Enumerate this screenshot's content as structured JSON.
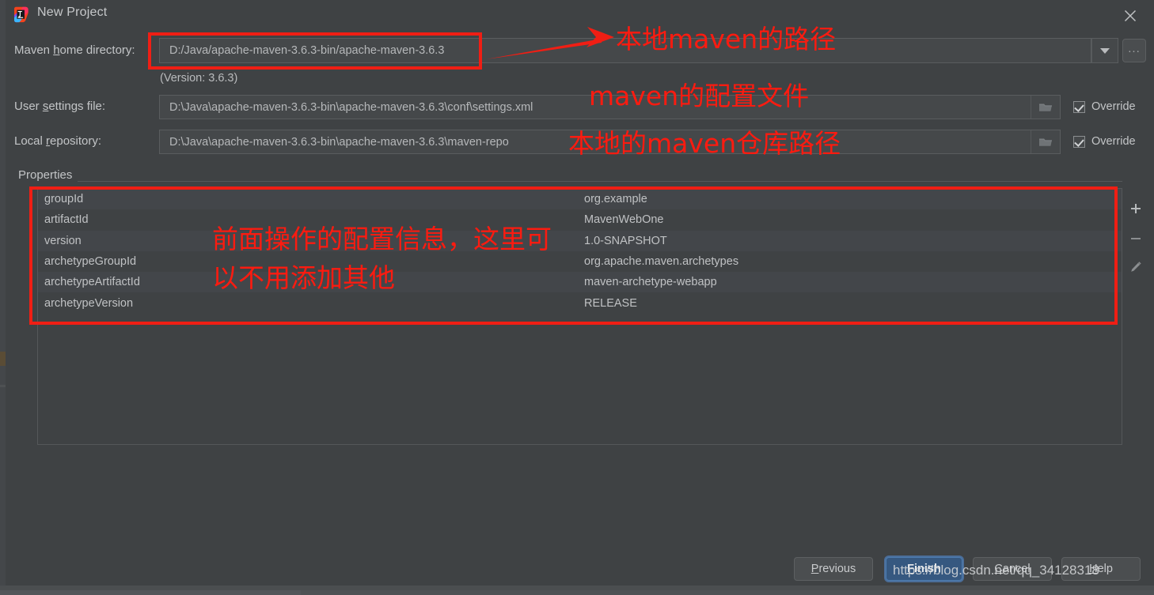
{
  "window": {
    "title": "New Project",
    "app_icon": "intellij-idea-icon",
    "close_icon": "close-icon"
  },
  "form": {
    "maven_home": {
      "label_pre": "Maven ",
      "label_mnemonic": "h",
      "label_post": "ome directory:",
      "value": "D:/Java/apache-maven-3.6.3-bin/apache-maven-3.6.3",
      "dropdown_icon": "chevron-down-icon",
      "browse_label": "...",
      "version_note": "(Version: 3.6.3)"
    },
    "user_settings": {
      "label_pre": "User ",
      "label_mnemonic": "s",
      "label_post": "ettings file:",
      "value": "D:\\Java\\apache-maven-3.6.3-bin\\apache-maven-3.6.3\\conf\\settings.xml",
      "folder_icon": "folder-icon",
      "override_label": "Override",
      "override_checked": true
    },
    "local_repository": {
      "label_pre": "Local ",
      "label_mnemonic": "r",
      "label_post": "epository:",
      "value": "D:\\Java\\apache-maven-3.6.3-bin\\apache-maven-3.6.3\\maven-repo",
      "folder_icon": "folder-icon",
      "override_label": "Override",
      "override_checked": true
    }
  },
  "properties": {
    "group_label": "Properties",
    "rows": [
      {
        "key": "groupId",
        "value": "org.example"
      },
      {
        "key": "artifactId",
        "value": "MavenWebOne"
      },
      {
        "key": "version",
        "value": "1.0-SNAPSHOT"
      },
      {
        "key": "archetypeGroupId",
        "value": "org.apache.maven.archetypes"
      },
      {
        "key": "archetypeArtifactId",
        "value": "maven-archetype-webapp"
      },
      {
        "key": "archetypeVersion",
        "value": "RELEASE"
      }
    ],
    "toolbar": {
      "add_icon": "plus-icon",
      "remove_icon": "minus-icon",
      "edit_icon": "pencil-icon"
    }
  },
  "buttons": {
    "previous": {
      "pre": "",
      "mnemonic": "P",
      "post": "revious"
    },
    "finish": {
      "pre": "",
      "mnemonic": "F",
      "post": "inish"
    },
    "cancel": {
      "pre": "",
      "mnemonic": "C",
      "post": "ancel"
    },
    "help": {
      "pre": "",
      "mnemonic": "H",
      "post": "elp"
    }
  },
  "annotations": {
    "accent_color": "#fc1b10",
    "maven_path_note": "本地maven的路径",
    "settings_note": "maven的配置文件",
    "repo_note": "本地的maven仓库路径",
    "properties_note_line1": "前面操作的配置信息，这里可",
    "properties_note_line2": "以不用添加其他"
  },
  "watermark": {
    "text": "https://blog.csdn.net/qq_34128318"
  }
}
